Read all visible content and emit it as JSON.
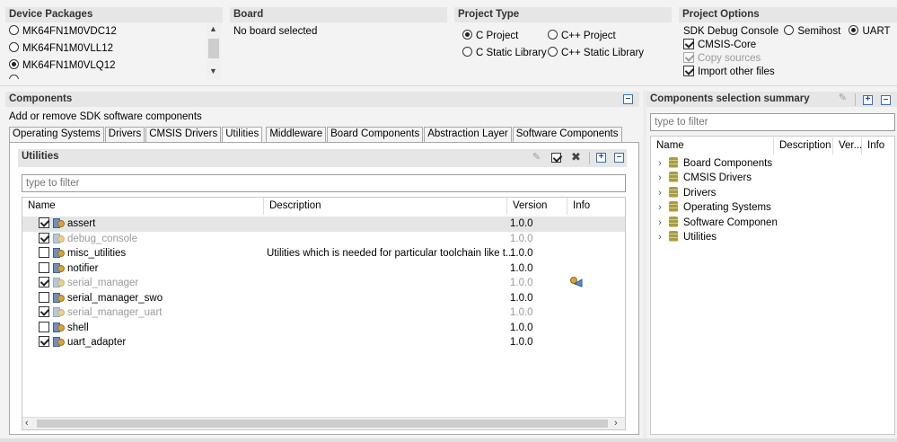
{
  "device_packages": {
    "title": "Device Packages",
    "items": [
      {
        "label": "MK64FN1M0VDC12",
        "selected": false
      },
      {
        "label": "MK64FN1M0VLL12",
        "selected": false
      },
      {
        "label": "MK64FN1M0VLQ12",
        "selected": true
      }
    ]
  },
  "board": {
    "title": "Board",
    "value": "No board selected"
  },
  "project_type": {
    "title": "Project Type",
    "options": [
      {
        "label": "C Project",
        "selected": true
      },
      {
        "label": "C++ Project",
        "selected": false
      },
      {
        "label": "C Static Library",
        "selected": false
      },
      {
        "label": "C++ Static Library",
        "selected": false
      }
    ]
  },
  "project_options": {
    "title": "Project Options",
    "debug_console_label": "SDK Debug Console",
    "semihost_label": "Semihost",
    "uart_label": "UART",
    "cmsis_core_label": "CMSIS-Core",
    "copy_sources_label": "Copy sources",
    "import_other_files_label": "Import other files"
  },
  "components": {
    "title": "Components",
    "subtitle": "Add or remove SDK software components",
    "tabs": [
      "Operating Systems",
      "Drivers",
      "CMSIS Drivers",
      "Utilities",
      "Middleware",
      "Board Components",
      "Abstraction Layer",
      "Software Components"
    ],
    "active_tab": "Utilities",
    "utilities": {
      "title": "Utilities",
      "filter_placeholder": "type to filter",
      "columns": {
        "name": "Name",
        "description": "Description",
        "version": "Version",
        "info": "Info"
      },
      "rows": [
        {
          "name": "assert",
          "description": "",
          "version": "1.0.0",
          "checked": true,
          "disabled": false
        },
        {
          "name": "debug_console",
          "description": "",
          "version": "1.0.0",
          "checked": true,
          "disabled": true
        },
        {
          "name": "misc_utilities",
          "description": "Utilities which is needed for particular toolchain like t...",
          "version": "1.0.0",
          "checked": false,
          "disabled": false
        },
        {
          "name": "notifier",
          "description": "",
          "version": "1.0.0",
          "checked": false,
          "disabled": false
        },
        {
          "name": "serial_manager",
          "description": "",
          "version": "1.0.0",
          "checked": true,
          "disabled": true
        },
        {
          "name": "serial_manager_swo",
          "description": "",
          "version": "1.0.0",
          "checked": false,
          "disabled": false
        },
        {
          "name": "serial_manager_uart",
          "description": "",
          "version": "1.0.0",
          "checked": true,
          "disabled": true
        },
        {
          "name": "shell",
          "description": "",
          "version": "1.0.0",
          "checked": false,
          "disabled": false
        },
        {
          "name": "uart_adapter",
          "description": "",
          "version": "1.0.0",
          "checked": true,
          "disabled": false
        }
      ]
    }
  },
  "summary": {
    "title": "Components selection summary",
    "filter_placeholder": "type to filter",
    "columns": {
      "name": "Name",
      "description": "Description",
      "version": "Ver...",
      "info": "Info"
    },
    "items": [
      "Board Components",
      "CMSIS Drivers",
      "Drivers",
      "Operating Systems",
      "Software Componen",
      "Utilities"
    ]
  }
}
